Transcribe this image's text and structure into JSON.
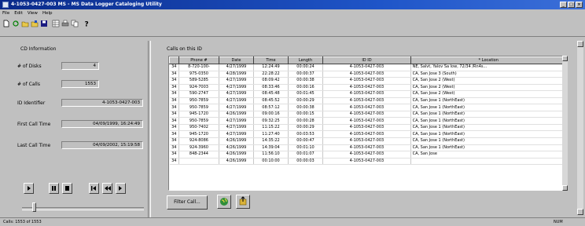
{
  "window": {
    "title": "4-1053-0427-003 MS - MS Data Logger Cataloging Utility"
  },
  "menu": [
    "File",
    "Edit",
    "View",
    "Help"
  ],
  "cd_info": {
    "heading": "CD Information",
    "num_disks_label": "# of Disks",
    "num_disks_value": "4",
    "num_calls_label": "# of Calls",
    "num_calls_value": "1553",
    "id_label": "ID Identifier",
    "id_value": "4-1053-0427-003",
    "first_call_label": "First Call Time",
    "first_call_value": "04/09/1999, 16:24:49",
    "last_call_label": "Last Call Time",
    "last_call_value": "04/09/2002, 15:19:58"
  },
  "calls_panel": {
    "heading": "Calls on this ID",
    "columns": [
      "",
      "Phone #",
      "Date",
      "Time",
      "Length",
      "ID ID",
      "* Location"
    ],
    "rows": [
      [
        "34",
        "8-720-100-",
        "4/27/1999",
        "12:24:49",
        "00:00:24",
        "4-1053-0427-003",
        "NE, Salvt, Yalov Sa low, 72/34 /Rn4s..."
      ],
      [
        "34",
        "975-0350",
        "4/28/1999",
        "22:28:22",
        "00:00:37",
        "4-1053-0427-003",
        "CA, San Jose 3 (South)"
      ],
      [
        "34",
        "589-5285",
        "4/27/1999",
        "08:09:42",
        "00:00:38",
        "4-1053-0427-003",
        "CA, San Jose 2 (West)"
      ],
      [
        "34",
        "924-7003",
        "4/27/1999",
        "08:33:46",
        "00:00:16",
        "4-1053-0427-003",
        "CA, San Jose 2 (West)"
      ],
      [
        "34",
        "590-2747",
        "4/27/1999",
        "08:45:48",
        "00:01:45",
        "4-1053-0427-003",
        "CA, San Jose 2 (West)"
      ],
      [
        "34",
        "950-7859",
        "4/27/1999",
        "08:45:52",
        "00:00:29",
        "4-1053-0427-003",
        "CA, San Jose 1 (NorthEast)"
      ],
      [
        "34",
        "950-7859",
        "4/27/1999",
        "08:57:12",
        "00:00:38",
        "4-1053-0427-003",
        "CA, San Jose 1 (NorthEast)"
      ],
      [
        "34",
        "945-1720",
        "4/26/1999",
        "09:00:16",
        "00:00:15",
        "4-1053-0427-003",
        "CA, San Jose 1 (NorthEast)"
      ],
      [
        "34",
        "950-7859",
        "4/27/1999",
        "09:32:25",
        "00:00:28",
        "4-1053-0427-003",
        "CA, San Jose 1 (NorthEast)"
      ],
      [
        "34",
        "950-7402",
        "4/27/1999",
        "11:15:22",
        "00:00:29",
        "4-1053-0427-003",
        "CA, San Jose 1 (NorthEast)"
      ],
      [
        "34",
        "945-1720",
        "4/27/1999",
        "11:27:40",
        "00:03:53",
        "4-1053-0427-003",
        "CA, San Jose 1 (NorthEast)"
      ],
      [
        "34",
        "924-8086",
        "4/26/1999",
        "14:35:22",
        "00:00:47",
        "4-1053-0427-003",
        "CA, San Jose 1 (NorthEast)"
      ],
      [
        "34",
        "924-3960",
        "4/26/1999",
        "14:39:04",
        "00:01:10",
        "4-1053-0427-003",
        "CA, San Jose 1 (NorthEast)"
      ],
      [
        "34",
        "848-2344",
        "4/26/1999",
        "11:56:10",
        "00:01:07",
        "4-1053-0427-003",
        "CA, San Jose"
      ],
      [
        "34",
        "",
        "4/26/1999",
        "00:10:00",
        "00:00:03",
        "4-1053-0427-003",
        ""
      ]
    ],
    "filter_button": "Filter Call..."
  },
  "status": {
    "left": "Calls: 1553 of 1553",
    "right": "NUM"
  }
}
